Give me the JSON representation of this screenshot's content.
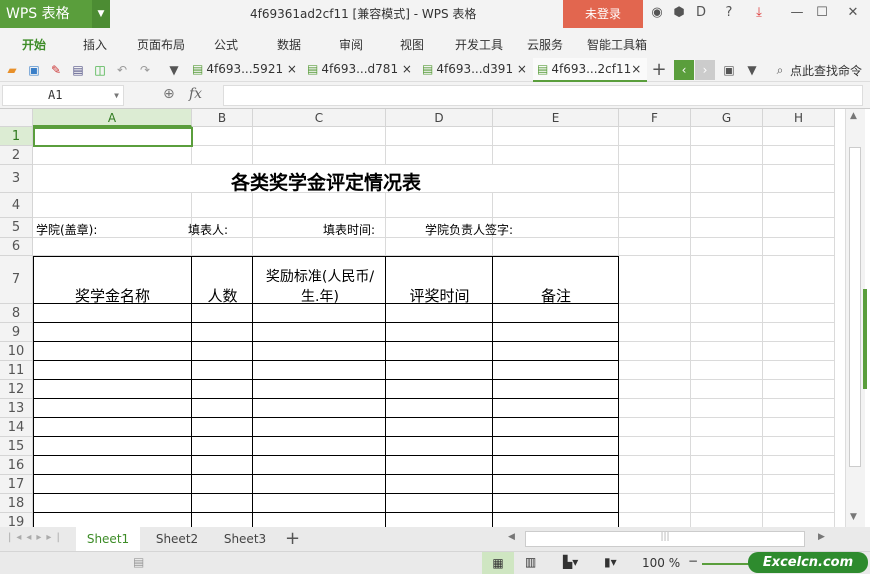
{
  "app": {
    "logo": "WPS 表格",
    "title": "4f69361ad2cf11 [兼容模式] - WPS 表格",
    "login": "未登录"
  },
  "menu": [
    "开始",
    "插入",
    "页面布局",
    "公式",
    "数据",
    "审阅",
    "视图",
    "开发工具",
    "云服务",
    "智能工具箱"
  ],
  "doc_tabs": [
    "4f693...5921",
    "4f693...d781",
    "4f693...d391",
    "4f693...2cf11"
  ],
  "search_cmd": "点此查找命令",
  "formula_bar": {
    "name_box": "A1",
    "fx": "fx",
    "value": ""
  },
  "columns": [
    "A",
    "B",
    "C",
    "D",
    "E",
    "F",
    "G",
    "H"
  ],
  "rows": [
    "1",
    "2",
    "3",
    "4",
    "5",
    "6",
    "7",
    "8",
    "9",
    "10",
    "11",
    "12",
    "13",
    "14",
    "15",
    "16",
    "17",
    "18",
    "19"
  ],
  "sheet": {
    "title": "各类奖学金评定情况表",
    "row5": [
      "学院(盖章):",
      "填表人:",
      "填表时间:",
      "学院负责人签字:"
    ],
    "headers": [
      "奖学金名称",
      "人数",
      "奖励标准(人民币/",
      "生.年)",
      "评奖时间",
      "备注"
    ]
  },
  "sheet_tabs": [
    "Sheet1",
    "Sheet2",
    "Sheet3"
  ],
  "status": {
    "zoom": "100 %",
    "brand": "Excelcn.com"
  },
  "colors": {
    "accent": "#5a9e3c",
    "login": "#e2664f"
  }
}
